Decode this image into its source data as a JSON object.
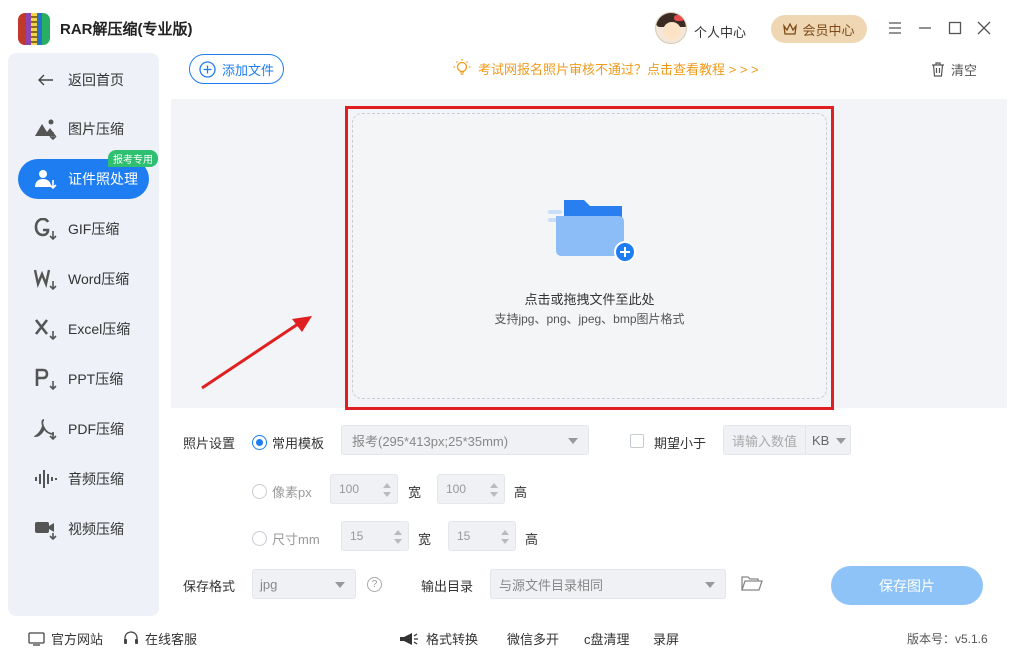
{
  "app": {
    "title": "RAR解压缩(专业版)"
  },
  "header": {
    "user_center": "个人中心",
    "vip_center": "会员中心"
  },
  "sidebar": {
    "back": "返回首页",
    "badge": "报考专用",
    "items": [
      {
        "label": "图片压缩",
        "icon": "image-compress-icon"
      },
      {
        "label": "证件照处理",
        "icon": "id-photo-icon",
        "active": true
      },
      {
        "label": "GIF压缩",
        "icon": "gif-icon"
      },
      {
        "label": "Word压缩",
        "icon": "word-icon"
      },
      {
        "label": "Excel压缩",
        "icon": "excel-icon"
      },
      {
        "label": "PPT压缩",
        "icon": "ppt-icon"
      },
      {
        "label": "PDF压缩",
        "icon": "pdf-icon"
      },
      {
        "label": "音频压缩",
        "icon": "audio-icon"
      },
      {
        "label": "视频压缩",
        "icon": "video-icon"
      }
    ]
  },
  "toolbar": {
    "add_file": "添加文件",
    "notice": "考试网报名照片审核不通过？点击查看教程 > > >",
    "clear": "清空"
  },
  "dropzone": {
    "title": "点击或拖拽文件至此处",
    "subtitle": "支持jpg、png、jpeg、bmp图片格式"
  },
  "settings": {
    "photo_settings_label": "照片设置",
    "template_radio": "常用模板",
    "template_value": "报考(295*413px;25*35mm)",
    "expect_less_label": "期望小于",
    "expect_placeholder": "请输入数值",
    "size_unit": "KB",
    "pixel_radio": "像素px",
    "pixel_width": "100",
    "pixel_height": "100",
    "width_label": "宽",
    "height_label": "高",
    "mm_radio": "尺寸mm",
    "mm_width": "15",
    "mm_height": "15",
    "save_format_label": "保存格式",
    "save_format_value": "jpg",
    "help": "?",
    "output_dir_label": "输出目录",
    "output_dir_value": "与源文件目录相同",
    "save_button": "保存图片"
  },
  "footer": {
    "website": "官方网站",
    "support": "在线客服",
    "format_convert": "格式转换",
    "wechat_multi": "微信多开",
    "c_clean": "c盘清理",
    "record": "录屏",
    "version": "版本号：v5.1.6"
  },
  "colors": {
    "accent": "#1e7df0",
    "notice": "#f09a1a",
    "highlight": "#e02020",
    "badge": "#2fbf71",
    "vip": "#f0d7b4"
  }
}
